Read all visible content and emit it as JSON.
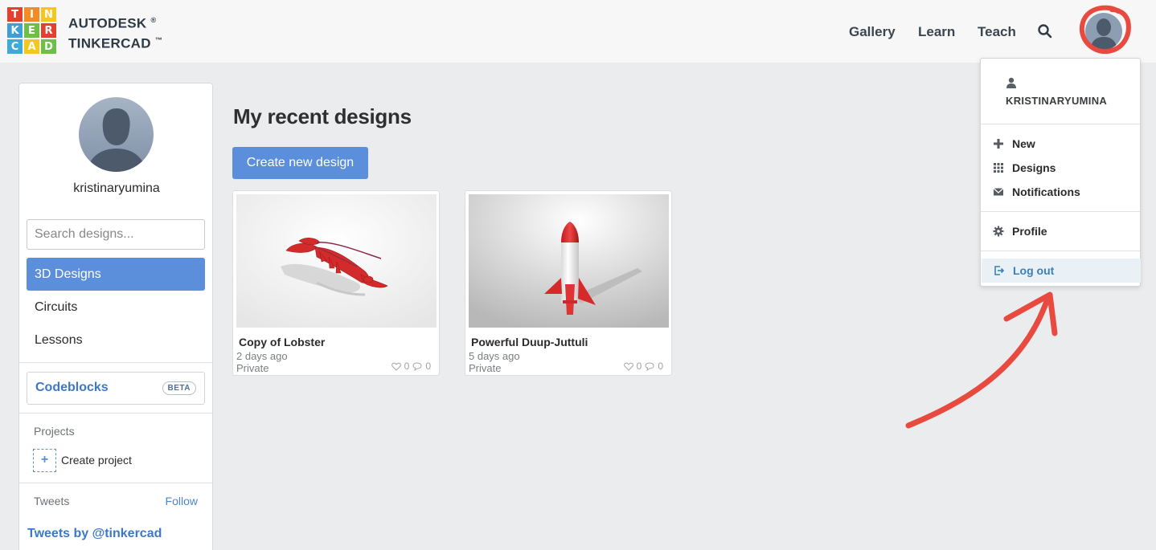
{
  "brand": {
    "logo_letters": [
      "T",
      "I",
      "N",
      "K",
      "E",
      "R",
      "C",
      "A",
      "D"
    ],
    "logo_colors": [
      "#e2412f",
      "#f58b24",
      "#f4c620",
      "#3d9fd9",
      "#6cc04a",
      "#e2412f",
      "#3fa9d8",
      "#f4c620",
      "#6cc04a"
    ],
    "line1": "AUTODESK",
    "line2": "TINKERCAD",
    "mark1": "®",
    "mark2": "™"
  },
  "nav": {
    "gallery": "Gallery",
    "learn": "Learn",
    "teach": "Teach",
    "search_icon": "search-icon"
  },
  "sidebar": {
    "username": "kristinaryumina",
    "search_placeholder": "Search designs...",
    "items": [
      {
        "label": "3D Designs",
        "active": true
      },
      {
        "label": "Circuits",
        "active": false
      },
      {
        "label": "Lessons",
        "active": false
      }
    ],
    "codeblocks": "Codeblocks",
    "beta": "BETA",
    "projects_label": "Projects",
    "create_project_icon": "+",
    "create_project": "Create project",
    "tweets_label": "Tweets",
    "follow": "Follow",
    "tweets_by": "Tweets by @tinkercad"
  },
  "main": {
    "title": "My recent designs",
    "create_button": "Create new design",
    "designs": [
      {
        "title": "Copy of Lobster",
        "date": "2 days ago",
        "privacy": "Private",
        "likes": "0",
        "comments": "0"
      },
      {
        "title": "Powerful Duup-Juttuli",
        "date": "5 days ago",
        "privacy": "Private",
        "likes": "0",
        "comments": "0"
      }
    ]
  },
  "dropdown": {
    "username": "KRISTINARYUMINA",
    "items": [
      {
        "label": "New",
        "icon": "plus-icon"
      },
      {
        "label": "Designs",
        "icon": "grid-icon"
      },
      {
        "label": "Notifications",
        "icon": "envelope-icon"
      }
    ],
    "profile": "Profile",
    "logout": "Log out"
  },
  "colors": {
    "accent": "#5b8fdb",
    "annotation_red": "#e84a3f"
  }
}
